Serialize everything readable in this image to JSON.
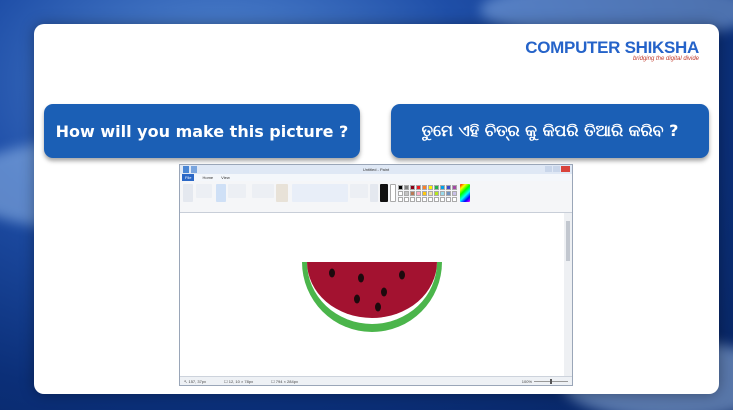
{
  "logo": {
    "name": "COMPUTER SHIKSHA",
    "tagline": "bridging the digital divide"
  },
  "questions": {
    "english": "How will you make this picture ?",
    "odia": "ତୁମେ ଏହି ଚିତ୍ର କୁ କିପରି ତିଆରି କରିବ ?"
  },
  "paint": {
    "title": "Untitled - Paint",
    "menu": [
      "File",
      "Home",
      "View"
    ],
    "status": {
      "cursor_pos": "↖ 157, 37px",
      "selection_size": "☐ 12, 10 × 78px",
      "image_size": "☐ 794 × 284px",
      "zoom": "100%"
    },
    "colors": {
      "rind_outer": "#4bb54b",
      "rind_inner": "#ffffff",
      "flesh": "#a31230",
      "seeds": "#1c0a0d"
    },
    "palette": [
      "#000000",
      "#7f7f7f",
      "#880015",
      "#ed1c24",
      "#ff7f27",
      "#fff200",
      "#22b14c",
      "#00a2e8",
      "#3f48cc",
      "#a349a4",
      "#ffffff",
      "#c3c3c3",
      "#b97a57",
      "#ffaec9",
      "#ffc90e",
      "#efe4b0",
      "#b5e61d",
      "#99d9ea",
      "#7092be",
      "#c8bfe7",
      "#ffffff",
      "#ffffff",
      "#ffffff",
      "#ffffff",
      "#ffffff",
      "#ffffff",
      "#ffffff",
      "#ffffff",
      "#ffffff",
      "#ffffff"
    ]
  }
}
